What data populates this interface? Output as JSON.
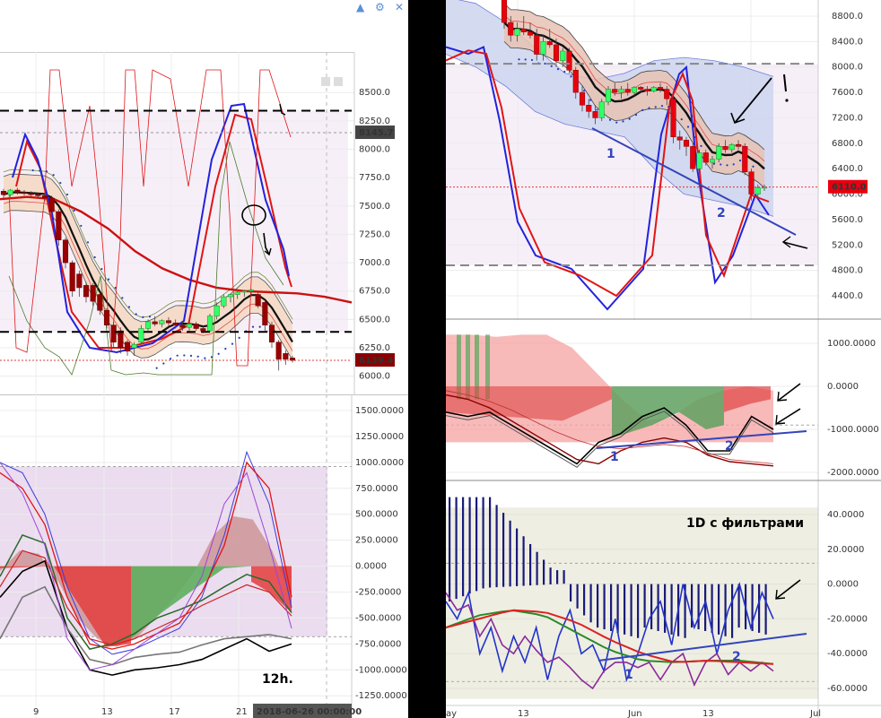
{
  "toolbar": {
    "icons": [
      "chevron-up-icon",
      "gear-icon",
      "close-icon"
    ],
    "glyph_up": "▲",
    "glyph_gear": "⚙",
    "glyph_close": "✕"
  },
  "colors": {
    "up": "#33ff66",
    "down": "#990000",
    "down_right": "#e8000f",
    "ribbon": "#f5d9c4",
    "cloud": "#cdd5ee",
    "bg_pink": "#f6eff8",
    "bg_lavender": "#e8d6ec",
    "bg_olive": "#eeeee2"
  },
  "chart_data": [
    {
      "id": "left-price",
      "type": "candlestick",
      "y_ticks": [
        6000.0,
        6250.0,
        6500.0,
        6750.0,
        7000.0,
        7250.0,
        7500.0,
        7750.0,
        8000.0,
        8250.0,
        8500.0
      ],
      "y_tick_labels": [
        "6000.0",
        "6250.0",
        "6500.0",
        "6750.0",
        "7000.0",
        "7250.0",
        "7500.0",
        "7750.0",
        "8000.0",
        "8250.0",
        "8500.0"
      ],
      "ylim": [
        5950,
        8620
      ],
      "x_ticks": [
        "9",
        "13",
        "17",
        "21"
      ],
      "price_label": "6139.4",
      "price_value": 6139.4,
      "marker_label": "8145.7",
      "marker_value": 8145.7,
      "levels_dashed": [
        8340,
        6390
      ],
      "levels_dotted": [
        8145.7,
        6139.4
      ],
      "candles": [
        [
          7630,
          7650,
          7570,
          7600
        ],
        [
          7600,
          7650,
          7580,
          7640
        ],
        [
          7640,
          7660,
          7600,
          7620
        ],
        [
          7620,
          7640,
          7590,
          7610
        ],
        [
          7610,
          7630,
          7580,
          7600
        ],
        [
          7600,
          7620,
          7570,
          7590
        ],
        [
          7590,
          7610,
          7540,
          7570
        ],
        [
          7570,
          7590,
          7400,
          7450
        ],
        [
          7450,
          7470,
          7150,
          7200
        ],
        [
          7200,
          7220,
          6950,
          7000
        ],
        [
          7000,
          7020,
          6700,
          6750
        ],
        [
          6900,
          6930,
          6700,
          6780
        ],
        [
          6800,
          6830,
          6650,
          6700
        ],
        [
          6800,
          6820,
          6620,
          6660
        ],
        [
          6720,
          6740,
          6540,
          6580
        ],
        [
          6580,
          6600,
          6420,
          6450
        ],
        [
          6450,
          6480,
          6250,
          6300
        ],
        [
          6400,
          6430,
          6200,
          6250
        ],
        [
          6300,
          6320,
          6180,
          6220
        ],
        [
          6250,
          6300,
          6180,
          6280
        ],
        [
          6300,
          6450,
          6280,
          6420
        ],
        [
          6420,
          6500,
          6400,
          6480
        ],
        [
          6480,
          6530,
          6440,
          6460
        ],
        [
          6460,
          6500,
          6430,
          6490
        ],
        [
          6490,
          6520,
          6440,
          6470
        ],
        [
          6470,
          6500,
          6420,
          6450
        ],
        [
          6450,
          6480,
          6400,
          6430
        ],
        [
          6430,
          6470,
          6400,
          6460
        ],
        [
          6460,
          6480,
          6400,
          6420
        ],
        [
          6420,
          6440,
          6380,
          6400
        ],
        [
          6400,
          6550,
          6390,
          6530
        ],
        [
          6530,
          6650,
          6500,
          6620
        ],
        [
          6620,
          6720,
          6600,
          6700
        ],
        [
          6700,
          6730,
          6650,
          6720
        ],
        [
          6720,
          6750,
          6680,
          6740
        ],
        [
          6740,
          6760,
          6700,
          6750
        ],
        [
          6750,
          6770,
          6700,
          6760
        ],
        [
          6720,
          6740,
          6600,
          6620
        ],
        [
          6650,
          6670,
          6400,
          6450
        ],
        [
          6450,
          6480,
          6250,
          6300
        ],
        [
          6300,
          6320,
          6050,
          6150
        ],
        [
          6200,
          6230,
          6100,
          6150
        ],
        [
          6160,
          6180,
          6120,
          6140
        ]
      ]
    },
    {
      "id": "left-oscillator",
      "type": "line",
      "y_ticks": [
        -1250,
        -1000,
        -750,
        -500,
        -250,
        0,
        250,
        500,
        750,
        1000,
        1250,
        1500
      ],
      "y_tick_labels": [
        "-1250.0000",
        "-1000.0000",
        "-750.0000",
        "-500.0000",
        "-250.0000",
        "0.0000",
        "250.0000",
        "500.0000",
        "750.0000",
        "1000.0000",
        "1250.0000",
        "1500.0000"
      ],
      "ylim": [
        -1300,
        1600
      ],
      "x_ticks": [
        "9",
        "13",
        "17",
        "21"
      ],
      "annotation": "12h.",
      "date_label": "2018-06-26 00:00:00"
    },
    {
      "id": "right-price",
      "type": "candlestick",
      "y_ticks": [
        4400.0,
        4800.0,
        5200.0,
        5600.0,
        6000.0,
        6400.0,
        6800.0,
        7200.0,
        7600.0,
        8000.0,
        8400.0,
        8800.0
      ],
      "y_tick_labels": [
        "4400.0",
        "4800.0",
        "5200.0",
        "5600.0",
        "6000.0",
        "6400.0",
        "6800.0",
        "7200.0",
        "7600.0",
        "8000.0",
        "8400.0",
        "8800.0"
      ],
      "ylim": [
        4200,
        9000
      ],
      "price_label": "6110.0",
      "price_value": 6110.0,
      "levels_dashed": [
        8050,
        4880
      ],
      "annotations": [
        "1",
        "2"
      ],
      "candles": [
        [
          9100,
          9200,
          8600,
          8700
        ],
        [
          8700,
          8800,
          8400,
          8500
        ],
        [
          8500,
          8700,
          8400,
          8600
        ],
        [
          8600,
          8800,
          8500,
          8550
        ],
        [
          8550,
          8700,
          8450,
          8500
        ],
        [
          8500,
          8600,
          8100,
          8200
        ],
        [
          8200,
          8500,
          8100,
          8400
        ],
        [
          8400,
          8600,
          8300,
          8350
        ],
        [
          8350,
          8450,
          8000,
          8100
        ],
        [
          8100,
          8300,
          8000,
          8250
        ],
        [
          8250,
          8300,
          7900,
          7950
        ],
        [
          7950,
          8000,
          7500,
          7600
        ],
        [
          7600,
          7700,
          7300,
          7400
        ],
        [
          7400,
          7500,
          7200,
          7300
        ],
        [
          7300,
          7400,
          7100,
          7200
        ],
        [
          7200,
          7500,
          7150,
          7450
        ],
        [
          7450,
          7700,
          7400,
          7650
        ],
        [
          7650,
          7750,
          7550,
          7600
        ],
        [
          7600,
          7700,
          7500,
          7650
        ],
        [
          7650,
          7750,
          7550,
          7600
        ],
        [
          7600,
          7700,
          7550,
          7680
        ],
        [
          7680,
          7700,
          7600,
          7650
        ],
        [
          7650,
          7700,
          7550,
          7620
        ],
        [
          7620,
          7700,
          7600,
          7680
        ],
        [
          7680,
          7750,
          7600,
          7650
        ],
        [
          7650,
          7700,
          7400,
          7500
        ],
        [
          7500,
          7550,
          6800,
          6900
        ],
        [
          6900,
          7000,
          6700,
          6850
        ],
        [
          6850,
          6900,
          6600,
          6750
        ],
        [
          6750,
          6800,
          6350,
          6400
        ],
        [
          6400,
          6700,
          6350,
          6650
        ],
        [
          6650,
          6700,
          6450,
          6500
        ],
        [
          6500,
          6600,
          6400,
          6550
        ],
        [
          6550,
          6800,
          6500,
          6750
        ],
        [
          6750,
          6850,
          6650,
          6700
        ],
        [
          6700,
          6800,
          6650,
          6780
        ],
        [
          6780,
          6850,
          6700,
          6750
        ],
        [
          6750,
          6800,
          6300,
          6350
        ],
        [
          6350,
          6400,
          5900,
          6000
        ],
        [
          6000,
          6150,
          5950,
          6100
        ],
        [
          6100,
          6150,
          6050,
          6110
        ]
      ]
    },
    {
      "id": "right-middle-oscillator",
      "type": "area",
      "y_ticks": [
        -2000,
        -1000,
        0,
        1000
      ],
      "y_tick_labels": [
        "-2000.0000",
        "-1000.0000",
        "0.0000",
        "1000.0000"
      ],
      "ylim": [
        -2200,
        1600
      ],
      "annotations": [
        "1",
        "2"
      ]
    },
    {
      "id": "right-bottom-histogram",
      "type": "bar",
      "y_ticks": [
        -60,
        -40,
        -20,
        0,
        20,
        40
      ],
      "y_tick_labels": [
        "-60.0000",
        "-40.0000",
        "-20.0000",
        "0.0000",
        "20.0000",
        "40.0000"
      ],
      "ylim": [
        -66,
        50
      ],
      "x_ticks": [
        "ay",
        "13",
        "Jun",
        "13",
        "Jul"
      ],
      "title": "1D  с фильтрами",
      "annotations": [
        "1",
        "2"
      ]
    }
  ]
}
